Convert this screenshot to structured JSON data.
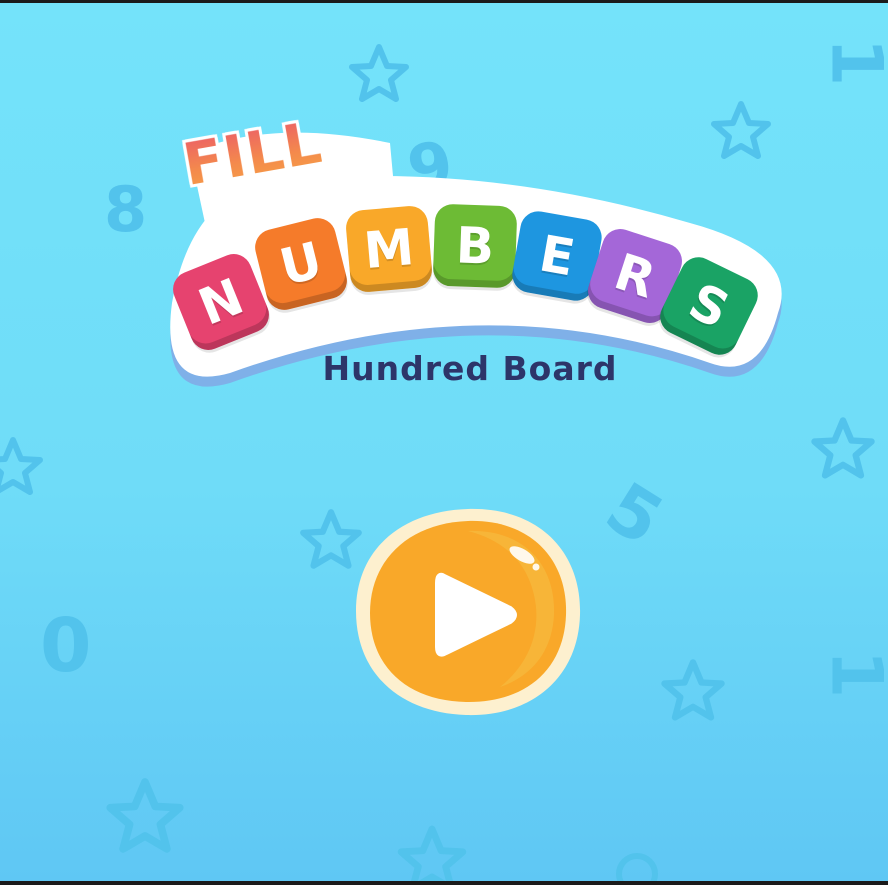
{
  "logo": {
    "word1": "FILL",
    "letters": [
      "N",
      "U",
      "M",
      "B",
      "E",
      "R",
      "S"
    ],
    "letter_colors": [
      "#e6436f",
      "#f57b2a",
      "#f9a829",
      "#6dbb35",
      "#1e96e0",
      "#a467d8",
      "#1aa365"
    ],
    "subtitle": "Hundred Board"
  },
  "background": {
    "digits": [
      "8",
      "9",
      "5",
      "0",
      "1",
      "1"
    ],
    "decorations": [
      "star-icon"
    ]
  },
  "play_button": {
    "icon": "play-icon",
    "fill_color": "#f9a829",
    "rim_color": "#fdf0cf"
  },
  "colors": {
    "background": "#72e0f9",
    "decoration": "#52c3ec",
    "subtitle": "#2d3569"
  }
}
